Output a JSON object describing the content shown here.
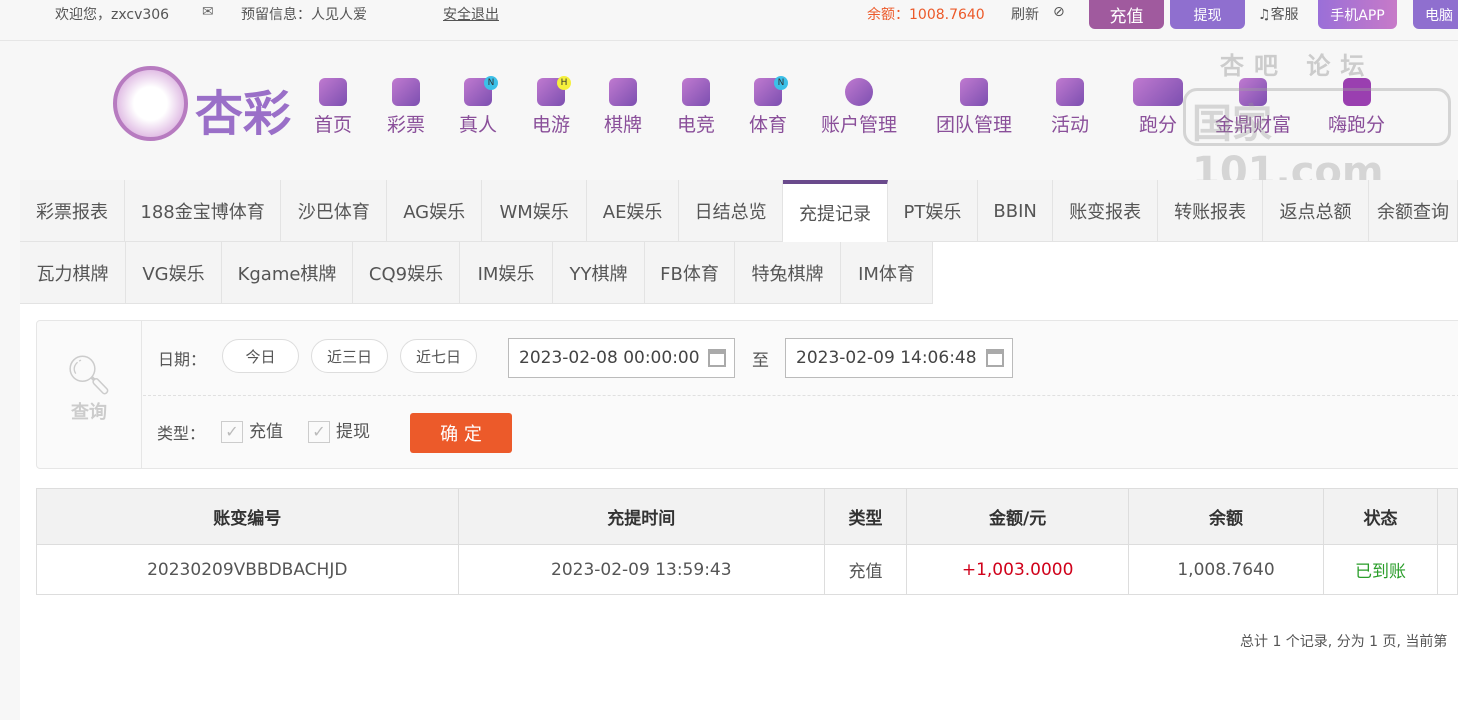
{
  "topbar": {
    "welcome": "欢迎您，zxcv306",
    "reserved": "预留信息：人见人爱",
    "logout": "安全退出",
    "balance": "余额：1008.7640",
    "refresh": "刷新",
    "deposit": "充值",
    "withdraw": "提现",
    "service": "客服",
    "mobile_app": "手机APP",
    "pc": "电脑"
  },
  "logo": "杏彩",
  "nav": [
    {
      "label": "首页"
    },
    {
      "label": "彩票"
    },
    {
      "label": "真人",
      "badge": "N"
    },
    {
      "label": "电游",
      "badge": "H"
    },
    {
      "label": "棋牌"
    },
    {
      "label": "电竞"
    },
    {
      "label": "体育",
      "badge": "N"
    },
    {
      "label": "账户管理"
    },
    {
      "label": "团队管理"
    },
    {
      "label": "活动"
    },
    {
      "label": "跑分"
    },
    {
      "label": "金鼎财富"
    },
    {
      "label": "嗨跑分"
    }
  ],
  "watermark": {
    "line1": "杏吧 论坛",
    "line2": "国家101.com"
  },
  "tabs_row1": [
    "彩票报表",
    "188金宝博体育",
    "沙巴体育",
    "AG娱乐",
    "WM娱乐",
    "AE娱乐",
    "日结总览",
    "充提记录",
    "PT娱乐",
    "BBIN",
    "账变报表",
    "转账报表",
    "返点总额",
    "余额查询"
  ],
  "tabs_row2": [
    "瓦力棋牌",
    "VG娱乐",
    "Kgame棋牌",
    "CQ9娱乐",
    "IM娱乐",
    "YY棋牌",
    "FB体育",
    "特兔棋牌",
    "IM体育"
  ],
  "filter": {
    "search_label": "查询",
    "date_label": "日期：",
    "today": "今日",
    "three_days": "近三日",
    "seven_days": "近七日",
    "start": "2023-02-08 00:00:00",
    "to": "至",
    "end": "2023-02-09 14:06:48",
    "type_label": "类型：",
    "type_deposit": "充值",
    "type_withdraw": "提现",
    "confirm": "确 定"
  },
  "table": {
    "headers": [
      "账变编号",
      "充提时间",
      "类型",
      "金额/元",
      "余额",
      "状态"
    ],
    "rows": [
      {
        "id": "20230209VBBDBACHJD",
        "time": "2023-02-09 13:59:43",
        "type": "充值",
        "amount": "+1,003.0000",
        "balance": "1,008.7640",
        "status": "已到账"
      }
    ]
  },
  "pagination": "总计 1 个记录, 分为 1 页, 当前第",
  "colors": {
    "accent": "#8a4f9a",
    "amount": "#d0021b",
    "status": "#2a9d2a",
    "confirm": "#ec5a2a"
  }
}
